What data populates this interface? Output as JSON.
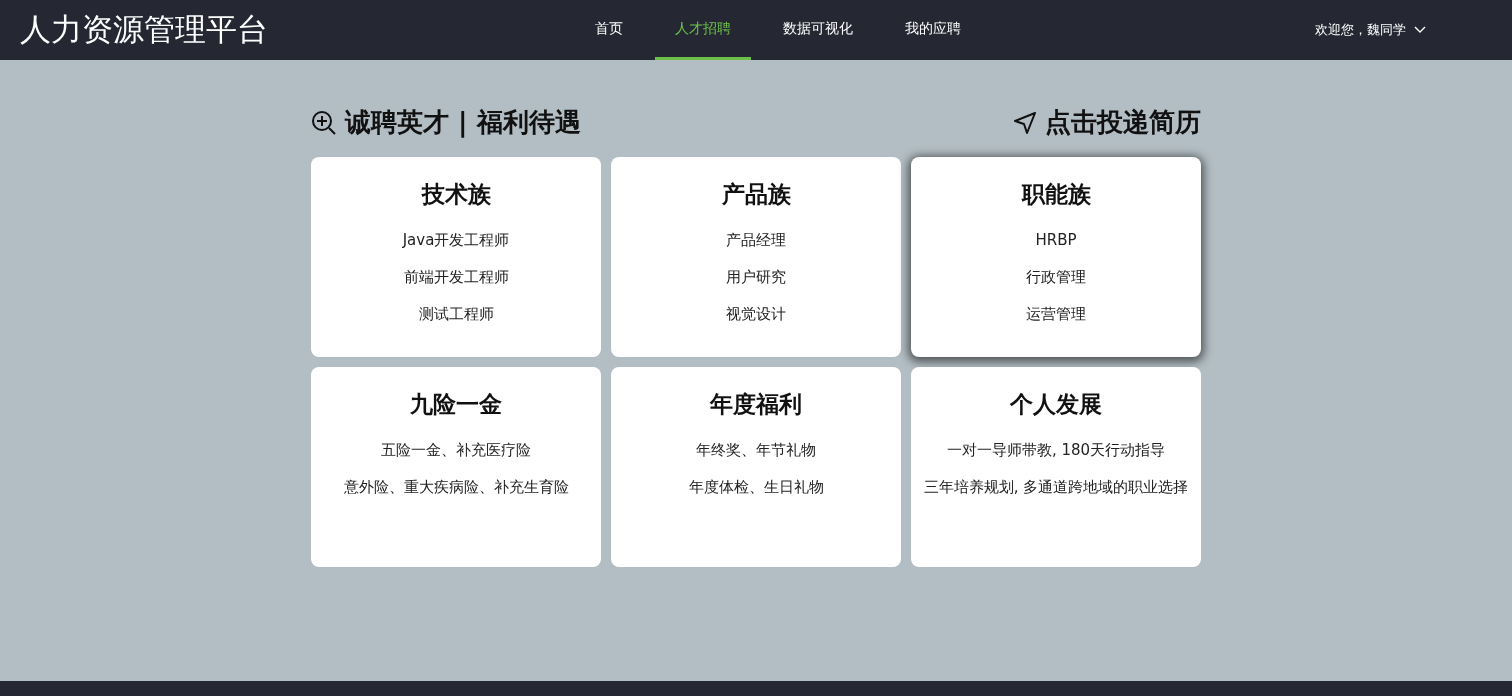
{
  "header": {
    "title": "人力资源管理平台",
    "nav": [
      {
        "label": "首页",
        "selected": false
      },
      {
        "label": "人才招聘",
        "selected": true
      },
      {
        "label": "数据可视化",
        "selected": false
      },
      {
        "label": "我的应聘",
        "selected": false
      }
    ],
    "user": "欢迎您，魏同学"
  },
  "headings": {
    "left": "诚聘英才 | 福利待遇",
    "right": "点击投递简历"
  },
  "cards": [
    {
      "title": "技术族",
      "items": [
        "Java开发工程师",
        "前端开发工程师",
        "测试工程师"
      ],
      "raised": false
    },
    {
      "title": "产品族",
      "items": [
        "产品经理",
        "用户研究",
        "视觉设计"
      ],
      "raised": false
    },
    {
      "title": "职能族",
      "items": [
        "HRBP",
        "行政管理",
        "运营管理"
      ],
      "raised": true
    },
    {
      "title": "九险一金",
      "items": [
        "五险一金、补充医疗险",
        "意外险、重大疾病险、补充生育险"
      ],
      "raised": false
    },
    {
      "title": "年度福利",
      "items": [
        "年终奖、年节礼物",
        "年度体检、生日礼物"
      ],
      "raised": false
    },
    {
      "title": "个人发展",
      "items": [
        "一对一导师带教, 180天行动指导",
        "三年培养规划, 多通道跨地域的职业选择"
      ],
      "raised": false
    }
  ]
}
